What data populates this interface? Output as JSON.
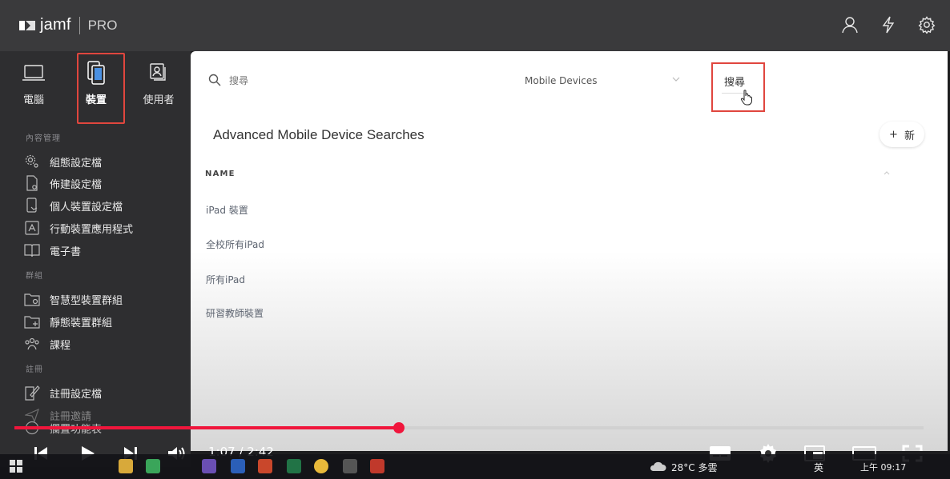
{
  "app": {
    "brand": "jamf",
    "product": "PRO"
  },
  "topbar_icons": [
    "user-icon",
    "lightning-icon",
    "gear-icon"
  ],
  "categories": [
    {
      "label": "電腦",
      "icon": "laptop-icon",
      "active": false
    },
    {
      "label": "裝置",
      "icon": "mobile-device-icon",
      "active": true
    },
    {
      "label": "使用者",
      "icon": "users-icon",
      "active": false
    }
  ],
  "sidebar": {
    "section_content": "內容管理",
    "content_items": [
      {
        "label": "組態設定檔",
        "icon": "gear-cog-icon"
      },
      {
        "label": "佈建設定檔",
        "icon": "document-gear-icon"
      },
      {
        "label": "個人裝置設定檔",
        "icon": "device-hand-icon"
      },
      {
        "label": "行動裝置應用程式",
        "icon": "app-store-icon"
      },
      {
        "label": "電子書",
        "icon": "book-icon"
      }
    ],
    "section_groups": "群組",
    "group_items": [
      {
        "label": "智慧型裝置群組",
        "icon": "smart-folder-icon"
      },
      {
        "label": "靜態裝置群組",
        "icon": "static-folder-icon"
      },
      {
        "label": "課程",
        "icon": "people-group-icon"
      }
    ],
    "section_enroll": "註冊",
    "enroll_items": [
      {
        "label": "註冊設定檔",
        "icon": "pencil-document-icon"
      },
      {
        "label": "註冊邀請",
        "icon": "send-icon"
      },
      {
        "label": "攔置功能表",
        "icon": "circle-icon"
      }
    ]
  },
  "search": {
    "placeholder": "搜尋",
    "dropdown_value": "Mobile Devices",
    "button_label": "搜尋"
  },
  "main": {
    "title": "Advanced Mobile Device Searches",
    "add_label": "新",
    "column_name": "NAME",
    "rows": [
      "iPad 裝置",
      "全校所有iPad",
      "所有iPad",
      "研習教師裝置"
    ]
  },
  "video": {
    "time": "1:07 / 2:42",
    "progress": 0.4225
  },
  "taskbar": {
    "weather": "28°C 多雲",
    "lang": "英",
    "clock": "上午 09:17"
  },
  "colors": {
    "highlight": "#e0463e",
    "progress": "#f0163c",
    "sidebar_bg": "#2e2e30",
    "topbar_bg": "#3a3a3c"
  }
}
